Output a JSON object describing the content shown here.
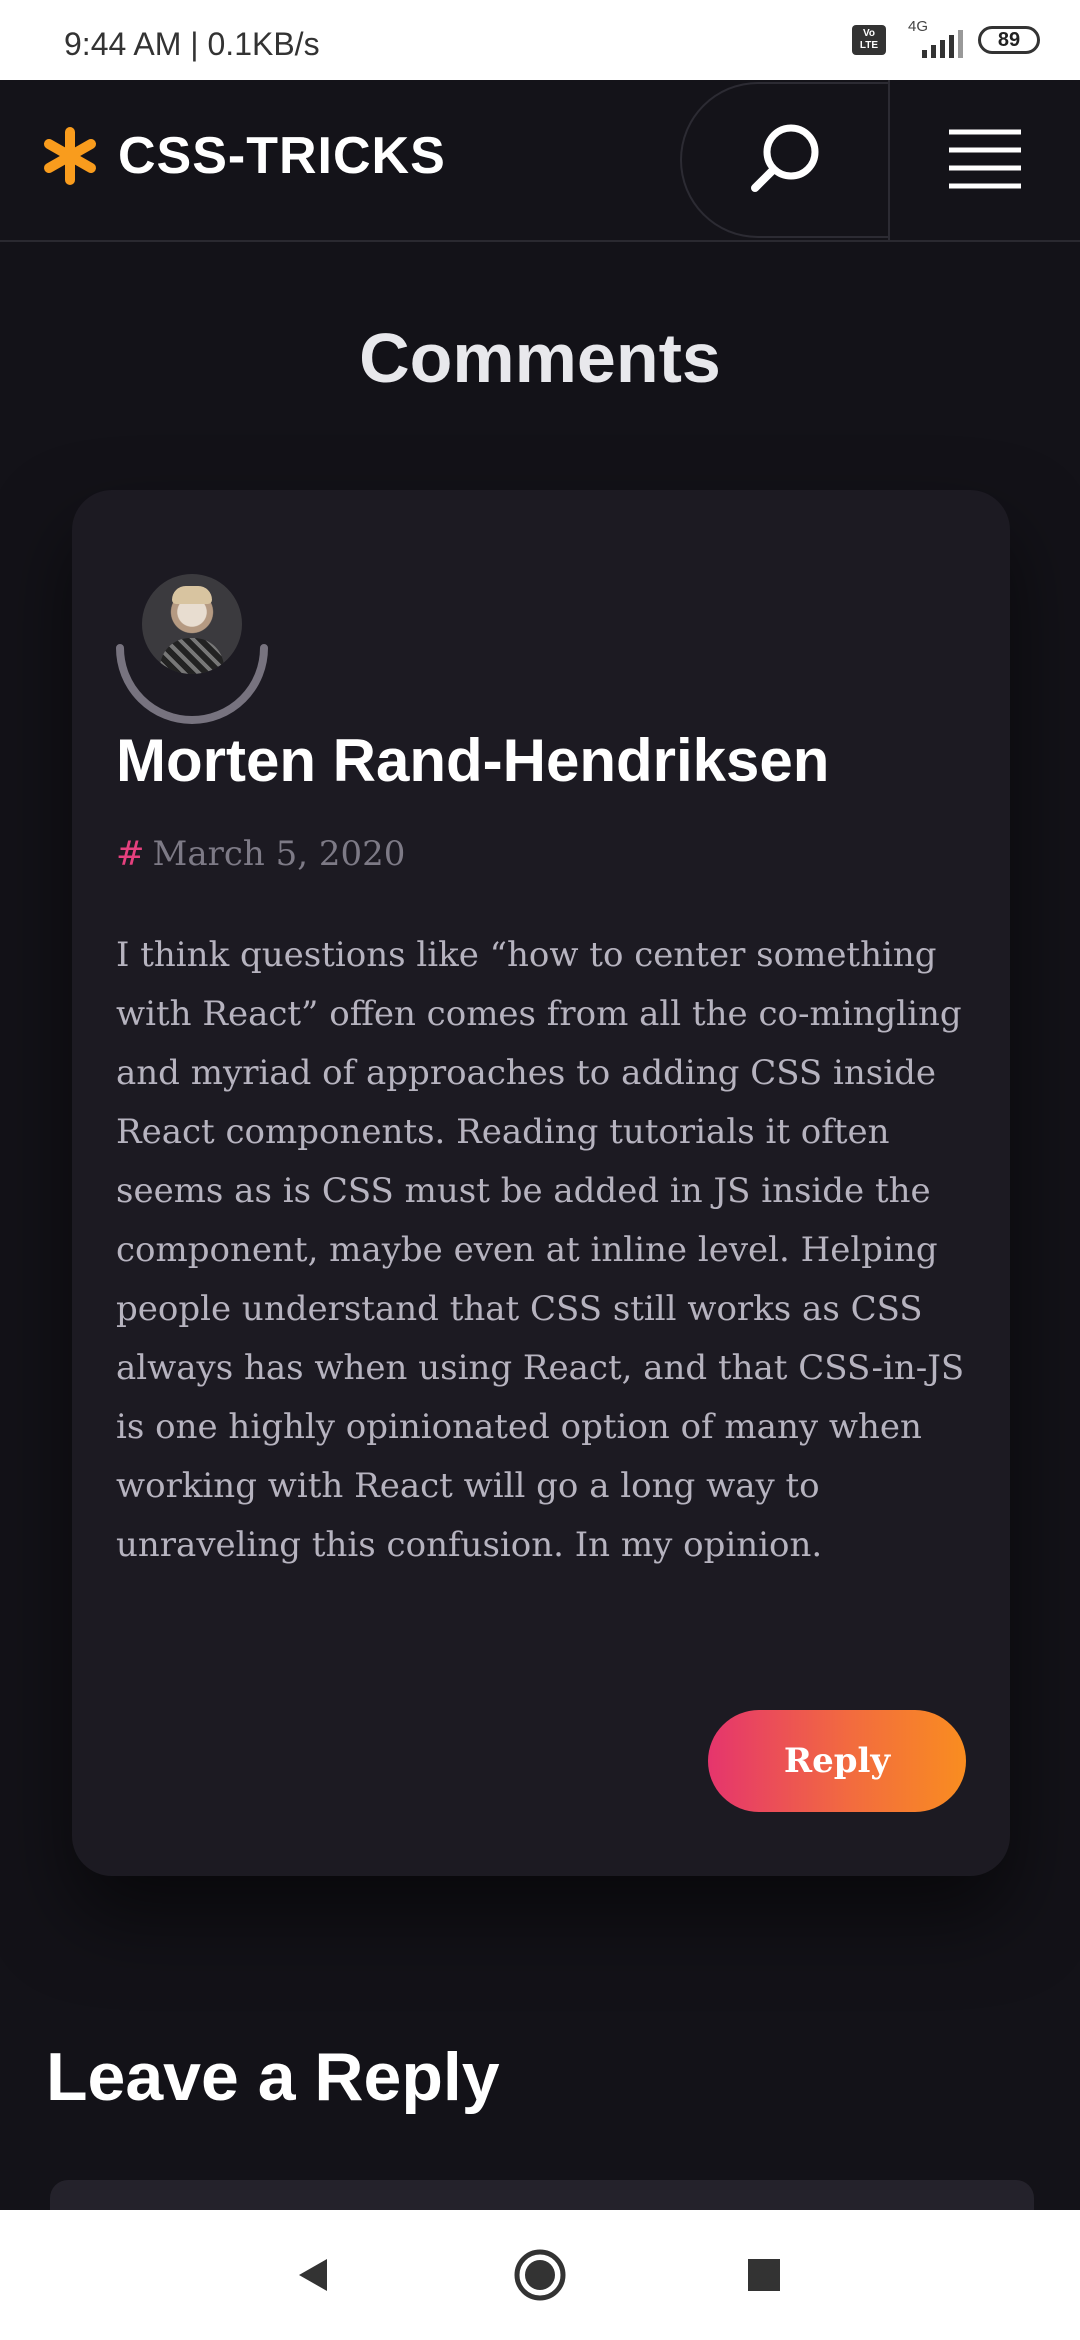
{
  "status_bar": {
    "time": "9:44 AM | 0.1KB/s",
    "volte": "Vo LTE",
    "network": "4G",
    "battery": "89"
  },
  "header": {
    "logo_text": "CSS-TRICKS",
    "logo_color": "#f99c1d",
    "search_icon": "search-icon",
    "menu_icon": "hamburger-menu-icon"
  },
  "comments": {
    "title": "Comments",
    "items": [
      {
        "author": "Morten Rand-Hendriksen",
        "date_hash": "#",
        "date": "March 5, 2020",
        "body": "I think questions like “how to center something with React” offen comes from all the co-mingling and myriad of approaches to adding CSS inside React components. Reading tutorials it often seems as is CSS must be added in JS inside the component, maybe even at inline level. Helping people understand that CSS still works as CSS always has when using React, and that CSS-in-JS is one highly opinionated option of many when working with React will go a long way to unraveling this confusion. In my opinion.",
        "reply_label": "Reply"
      }
    ]
  },
  "reply_section": {
    "title": "Leave a Reply"
  },
  "nav_bar": {
    "back_icon": "back-triangle-icon",
    "home_icon": "home-circle-icon",
    "recents_icon": "recents-square-icon"
  },
  "colors": {
    "background": "#131218",
    "card": "#1c1a22",
    "accent_pink": "#e5407e",
    "reply_gradient_start": "#e5356d",
    "reply_gradient_end": "#f98d20"
  }
}
